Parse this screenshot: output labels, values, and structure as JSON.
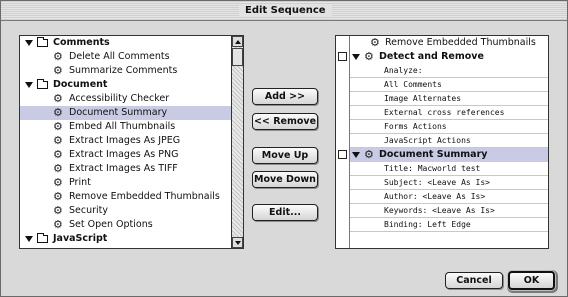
{
  "window": {
    "title": "Edit Sequence"
  },
  "left_tree": [
    {
      "type": "group",
      "label": "Comments"
    },
    {
      "type": "item",
      "label": "Delete All Comments"
    },
    {
      "type": "item",
      "label": "Summarize Comments"
    },
    {
      "type": "group",
      "label": "Document"
    },
    {
      "type": "item",
      "label": "Accessibility Checker"
    },
    {
      "type": "item",
      "label": "Document Summary",
      "selected": true
    },
    {
      "type": "item",
      "label": "Embed All Thumbnails"
    },
    {
      "type": "item",
      "label": "Extract Images As JPEG"
    },
    {
      "type": "item",
      "label": "Extract Images As PNG"
    },
    {
      "type": "item",
      "label": "Extract Images As TIFF"
    },
    {
      "type": "item",
      "label": "Print"
    },
    {
      "type": "item",
      "label": "Remove Embedded Thumbnails"
    },
    {
      "type": "item",
      "label": "Security"
    },
    {
      "type": "item",
      "label": "Set Open Options"
    },
    {
      "type": "group",
      "label": "JavaScript"
    }
  ],
  "buttons": {
    "add": "Add >>",
    "remove": "<< Remove",
    "move_up": "Move Up",
    "move_down": "Move Down",
    "edit": "Edit...",
    "cancel": "Cancel",
    "ok": "OK"
  },
  "sequence": [
    {
      "type": "item",
      "label": "Remove Embedded Thumbnails",
      "checkbox": false
    },
    {
      "type": "head",
      "label": "Detect and Remove",
      "checkbox": true
    },
    {
      "type": "sub",
      "label": "Analyze:"
    },
    {
      "type": "sub",
      "label": "All Comments"
    },
    {
      "type": "sub",
      "label": "Image Alternates"
    },
    {
      "type": "sub",
      "label": "External cross references"
    },
    {
      "type": "sub",
      "label": "Forms Actions"
    },
    {
      "type": "sub",
      "label": "JavaScript Actions"
    },
    {
      "type": "head",
      "label": "Document Summary",
      "checkbox": true,
      "selected": true
    },
    {
      "type": "sub",
      "label": "Title: Macworld test"
    },
    {
      "type": "sub",
      "label": "Subject: <Leave As Is>"
    },
    {
      "type": "sub",
      "label": "Author: <Leave As Is>"
    },
    {
      "type": "sub",
      "label": "Keywords: <Leave As Is>"
    },
    {
      "type": "sub",
      "label": "Binding: Left Edge"
    }
  ]
}
